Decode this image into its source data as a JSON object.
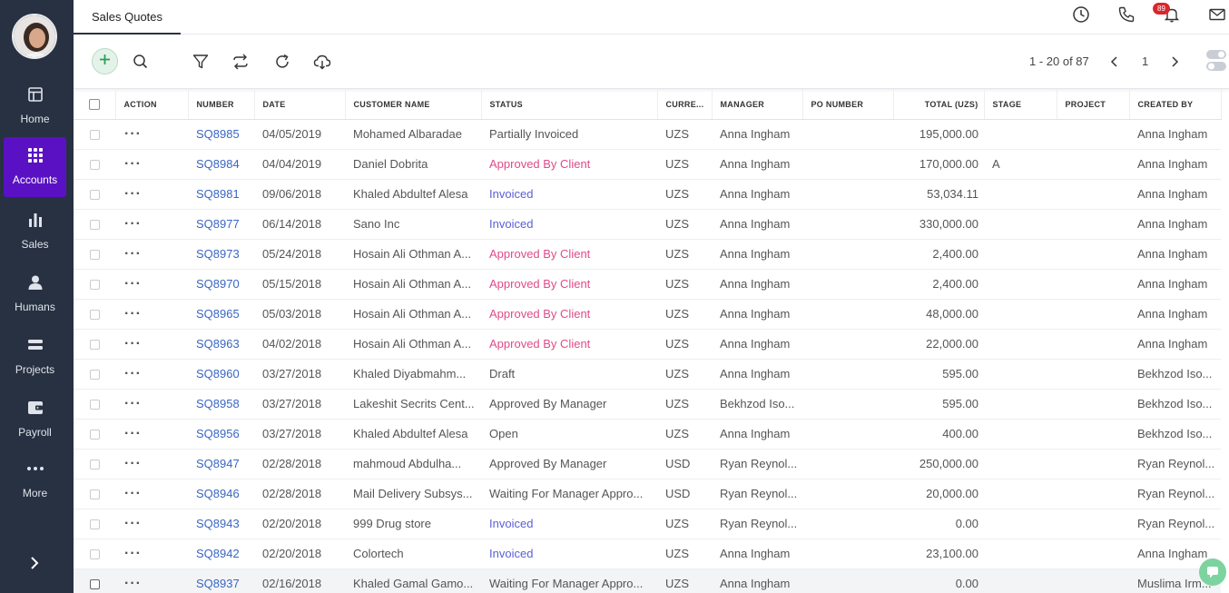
{
  "sidebar": {
    "items": [
      {
        "label": "Home",
        "icon": "home-icon"
      },
      {
        "label": "Accounts",
        "icon": "apps-grid-icon",
        "active": true
      },
      {
        "label": "Sales",
        "icon": "bar-chart-icon"
      },
      {
        "label": "Humans",
        "icon": "person-icon"
      },
      {
        "label": "Projects",
        "icon": "projects-icon"
      },
      {
        "label": "Payroll",
        "icon": "wallet-icon"
      },
      {
        "label": "More",
        "icon": "more-dots-icon"
      }
    ]
  },
  "tabs": [
    {
      "label": "Sales Quotes"
    }
  ],
  "header": {
    "notification_count": "89"
  },
  "pager": {
    "range": "1 - 20 of 87",
    "page": "1"
  },
  "colors": {
    "accent": "#5a11c4",
    "link": "#3a66c4",
    "approved_by_client": "#e04b8a",
    "invoiced": "#5b5fd6",
    "sidebar": "#273142"
  },
  "table": {
    "columns": [
      "ACTION",
      "NUMBER",
      "DATE",
      "CUSTOMER NAME",
      "STATUS",
      "CURRE...",
      "MANAGER",
      "PO NUMBER",
      "TOTAL (UZS)",
      "STAGE",
      "PROJECT",
      "CREATED BY"
    ],
    "rows": [
      {
        "number": "SQ8985",
        "date": "04/05/2019",
        "customer": "Mohamed Albaradae",
        "status": "Partially Invoiced",
        "status_type": "normal",
        "currency": "UZS",
        "manager": "Anna Ingham",
        "po": "",
        "total": "195,000.00",
        "stage": "",
        "project": "",
        "created_by": "Anna Ingham"
      },
      {
        "number": "SQ8984",
        "date": "04/04/2019",
        "customer": "Daniel Dobrita",
        "status": "Approved By Client",
        "status_type": "client",
        "currency": "UZS",
        "manager": "Anna Ingham",
        "po": "",
        "total": "170,000.00",
        "stage": "A",
        "project": "",
        "created_by": "Anna Ingham"
      },
      {
        "number": "SQ8981",
        "date": "09/06/2018",
        "customer": "Khaled Abdultef Alesa",
        "status": "Invoiced",
        "status_type": "invoiced",
        "currency": "UZS",
        "manager": "Anna Ingham",
        "po": "",
        "total": "53,034.11",
        "stage": "",
        "project": "",
        "created_by": "Anna Ingham"
      },
      {
        "number": "SQ8977",
        "date": "06/14/2018",
        "customer": "Sano Inc",
        "status": "Invoiced",
        "status_type": "invoiced",
        "currency": "UZS",
        "manager": "Anna Ingham",
        "po": "",
        "total": "330,000.00",
        "stage": "",
        "project": "",
        "created_by": "Anna Ingham"
      },
      {
        "number": "SQ8973",
        "date": "05/24/2018",
        "customer": "Hosain Ali Othman A...",
        "status": "Approved By Client",
        "status_type": "client",
        "currency": "UZS",
        "manager": "Anna Ingham",
        "po": "",
        "total": "2,400.00",
        "stage": "",
        "project": "",
        "created_by": "Anna Ingham"
      },
      {
        "number": "SQ8970",
        "date": "05/15/2018",
        "customer": "Hosain Ali Othman A...",
        "status": "Approved By Client",
        "status_type": "client",
        "currency": "UZS",
        "manager": "Anna Ingham",
        "po": "",
        "total": "2,400.00",
        "stage": "",
        "project": "",
        "created_by": "Anna Ingham"
      },
      {
        "number": "SQ8965",
        "date": "05/03/2018",
        "customer": "Hosain Ali Othman A...",
        "status": "Approved By Client",
        "status_type": "client",
        "currency": "UZS",
        "manager": "Anna Ingham",
        "po": "",
        "total": "48,000.00",
        "stage": "",
        "project": "",
        "created_by": "Anna Ingham"
      },
      {
        "number": "SQ8963",
        "date": "04/02/2018",
        "customer": "Hosain Ali Othman A...",
        "status": "Approved By Client",
        "status_type": "client",
        "currency": "UZS",
        "manager": "Anna Ingham",
        "po": "",
        "total": "22,000.00",
        "stage": "",
        "project": "",
        "created_by": "Anna Ingham"
      },
      {
        "number": "SQ8960",
        "date": "03/27/2018",
        "customer": "Khaled Diyabmahm...",
        "status": "Draft",
        "status_type": "normal",
        "currency": "UZS",
        "manager": "Anna Ingham",
        "po": "",
        "total": "595.00",
        "stage": "",
        "project": "",
        "created_by": "Bekhzod Iso..."
      },
      {
        "number": "SQ8958",
        "date": "03/27/2018",
        "customer": "Lakeshit Secrits Cent...",
        "status": "Approved By Manager",
        "status_type": "normal",
        "currency": "UZS",
        "manager": "Bekhzod Iso...",
        "po": "",
        "total": "595.00",
        "stage": "",
        "project": "",
        "created_by": "Bekhzod Iso..."
      },
      {
        "number": "SQ8956",
        "date": "03/27/2018",
        "customer": "Khaled Abdultef Alesa",
        "status": "Open",
        "status_type": "normal",
        "currency": "UZS",
        "manager": "Anna Ingham",
        "po": "",
        "total": "400.00",
        "stage": "",
        "project": "",
        "created_by": "Bekhzod Iso..."
      },
      {
        "number": "SQ8947",
        "date": "02/28/2018",
        "customer": "mahmoud Abdulha...",
        "status": "Approved By Manager",
        "status_type": "normal",
        "currency": "USD",
        "manager": "Ryan Reynol...",
        "po": "",
        "total": "250,000.00",
        "stage": "",
        "project": "",
        "created_by": "Ryan Reynol..."
      },
      {
        "number": "SQ8946",
        "date": "02/28/2018",
        "customer": "Mail Delivery Subsys...",
        "status": "Waiting For Manager Appro...",
        "status_type": "normal",
        "currency": "USD",
        "manager": "Ryan Reynol...",
        "po": "",
        "total": "20,000.00",
        "stage": "",
        "project": "",
        "created_by": "Ryan Reynol..."
      },
      {
        "number": "SQ8943",
        "date": "02/20/2018",
        "customer": "999 Drug store",
        "status": "Invoiced",
        "status_type": "invoiced",
        "currency": "UZS",
        "manager": "Ryan Reynol...",
        "po": "",
        "total": "0.00",
        "stage": "",
        "project": "",
        "created_by": "Ryan Reynol..."
      },
      {
        "number": "SQ8942",
        "date": "02/20/2018",
        "customer": "Colortech",
        "status": "Invoiced",
        "status_type": "invoiced",
        "currency": "UZS",
        "manager": "Anna Ingham",
        "po": "",
        "total": "23,100.00",
        "stage": "",
        "project": "",
        "created_by": "Anna Ingham"
      },
      {
        "number": "SQ8937",
        "date": "02/16/2018",
        "customer": "Khaled Gamal Gamo...",
        "status": "Waiting For Manager Appro...",
        "status_type": "normal",
        "currency": "UZS",
        "manager": "Anna Ingham",
        "po": "",
        "total": "0.00",
        "stage": "",
        "project": "",
        "created_by": "Muslima Irm..."
      }
    ]
  }
}
